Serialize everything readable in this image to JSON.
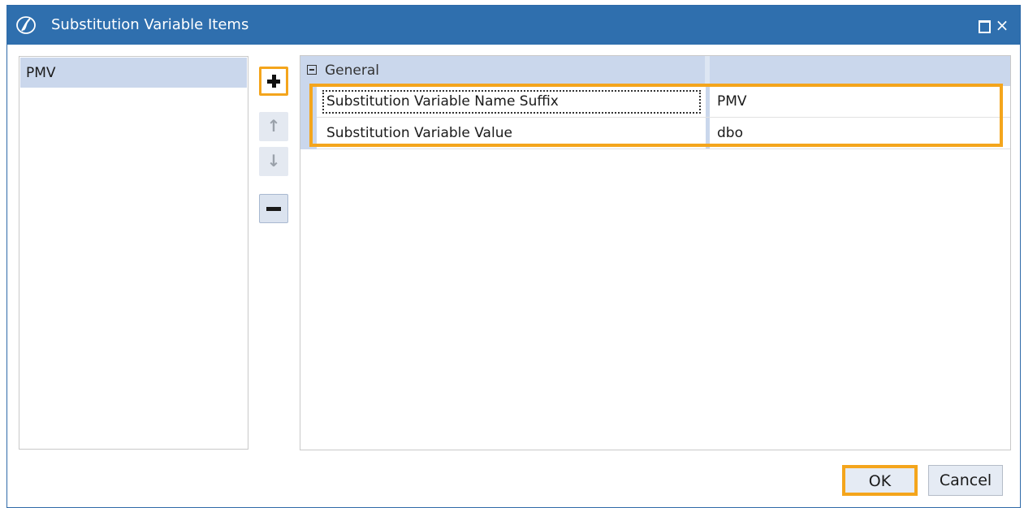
{
  "window": {
    "title": "Substitution Variable Items",
    "controls": {
      "maximize": "maximize-icon",
      "close": "×"
    }
  },
  "item_list": {
    "items": [
      {
        "label": "PMV",
        "selected": true
      }
    ]
  },
  "side_buttons": {
    "add": "plus-icon",
    "move_up": "↑",
    "move_down": "↓",
    "remove": "minus-icon"
  },
  "property_grid": {
    "group": {
      "label": "General",
      "expanded": true
    },
    "rows": [
      {
        "name": "Substitution Variable Name Suffix",
        "value": "PMV"
      },
      {
        "name": "Substitution Variable Value",
        "value": "dbo"
      }
    ]
  },
  "buttons": {
    "ok": "OK",
    "cancel": "Cancel"
  },
  "colors": {
    "titlebar": "#2f6fae",
    "highlight": "#f4a51c",
    "selection": "#cad7ec"
  }
}
